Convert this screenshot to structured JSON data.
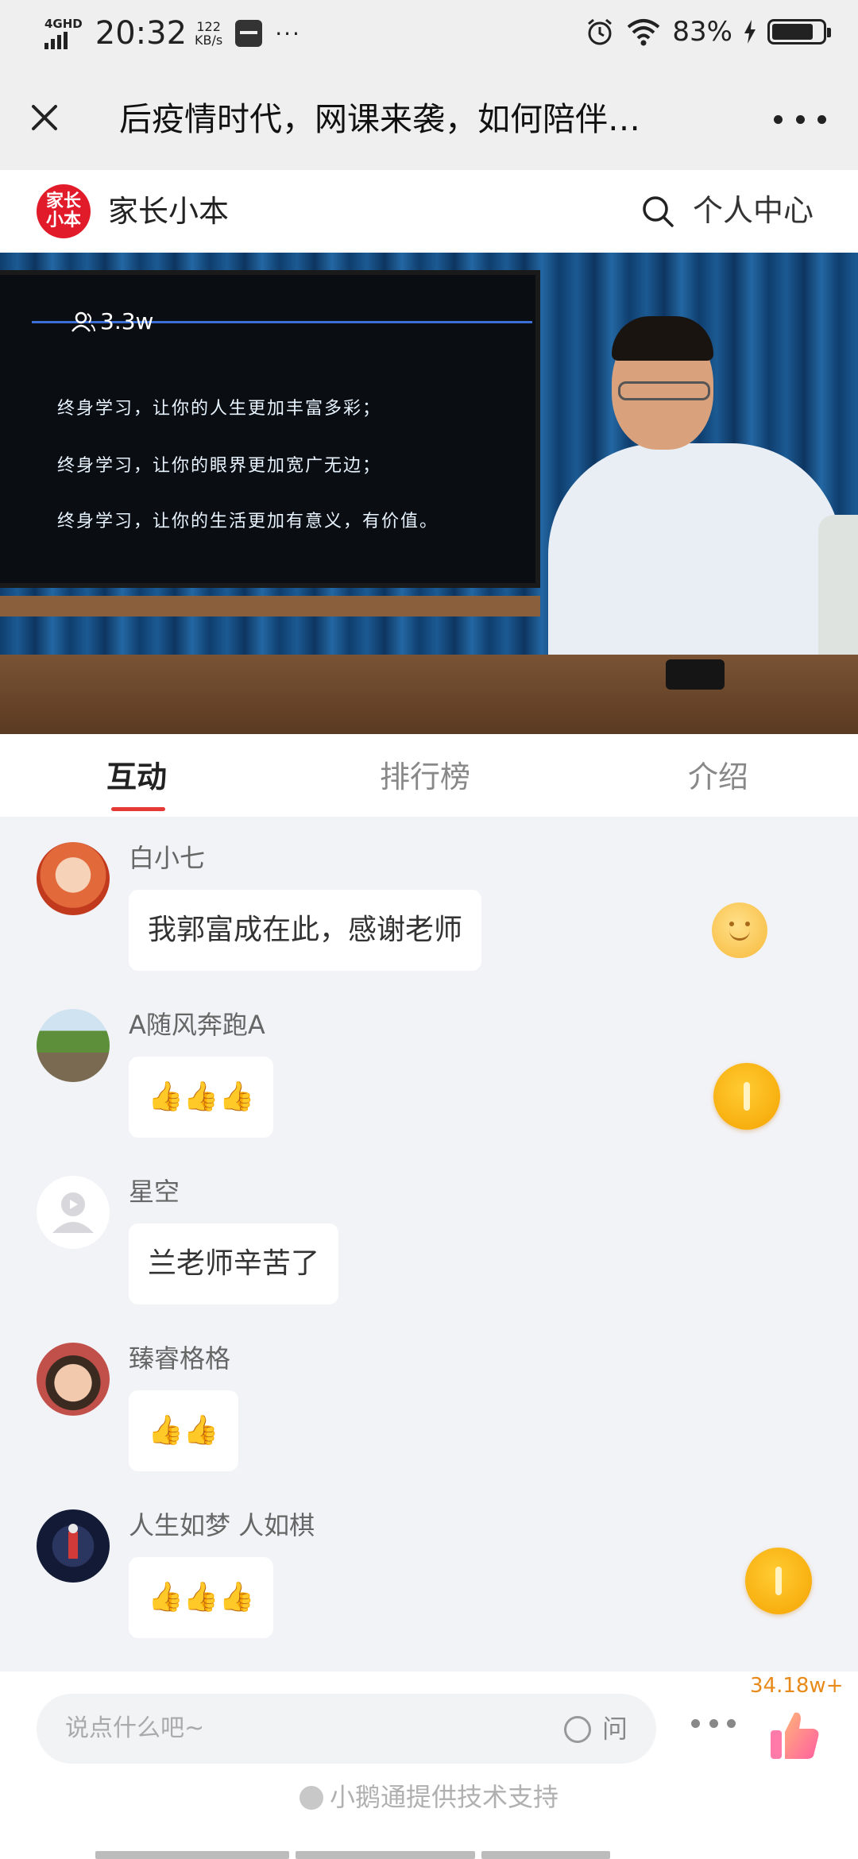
{
  "status_bar": {
    "network": "4GHD",
    "time": "20:32",
    "speed_value": "122",
    "speed_unit": "KB/s",
    "more": "···",
    "battery_percent": "83%",
    "battery_level": 0.83
  },
  "title_bar": {
    "title": "后疫情时代，网课来袭，如何陪伴…"
  },
  "header": {
    "logo_text_top": "家长",
    "logo_text_bottom": "小本",
    "brand_name": "家长小本",
    "personal_center": "个人中心"
  },
  "video": {
    "viewers": "3.3w",
    "lines": [
      "终身学习，让你的人生更加丰富多彩；",
      "终身学习，让你的眼界更加宽广无边；",
      "终身学习，让你的生活更加有意义，有价值。"
    ]
  },
  "tabs": [
    {
      "label": "互动",
      "active": true
    },
    {
      "label": "排行榜",
      "active": false
    },
    {
      "label": "介绍",
      "active": false
    }
  ],
  "messages": [
    {
      "nickname": "白小七",
      "text": "我郭富成在此，感谢老师",
      "avatar": "anime-avatar",
      "side_icon": "smile-emoji-icon"
    },
    {
      "nickname": "A随风奔跑A",
      "text": "👍👍👍",
      "avatar": "railway-avatar",
      "side_icon": "gold-coin-icon"
    },
    {
      "nickname": "星空",
      "text": "兰老师辛苦了",
      "avatar": "default-avatar",
      "side_icon": ""
    },
    {
      "nickname": "臻睿格格",
      "text": "👍👍",
      "avatar": "child-avatar",
      "side_icon": ""
    },
    {
      "nickname": "人生如梦 人如棋",
      "text": "👍👍👍",
      "avatar": "dark-avatar",
      "side_icon": "gold-coin-icon"
    }
  ],
  "composer": {
    "placeholder": "说点什么吧~",
    "ask_label": "问",
    "like_count": "34.18w+"
  },
  "footer": {
    "support_text": "小鹅通提供技术支持"
  },
  "colors": {
    "accent_red": "#e53935",
    "coin_gold": "#f5a300",
    "like_count": "#e88a1a"
  }
}
